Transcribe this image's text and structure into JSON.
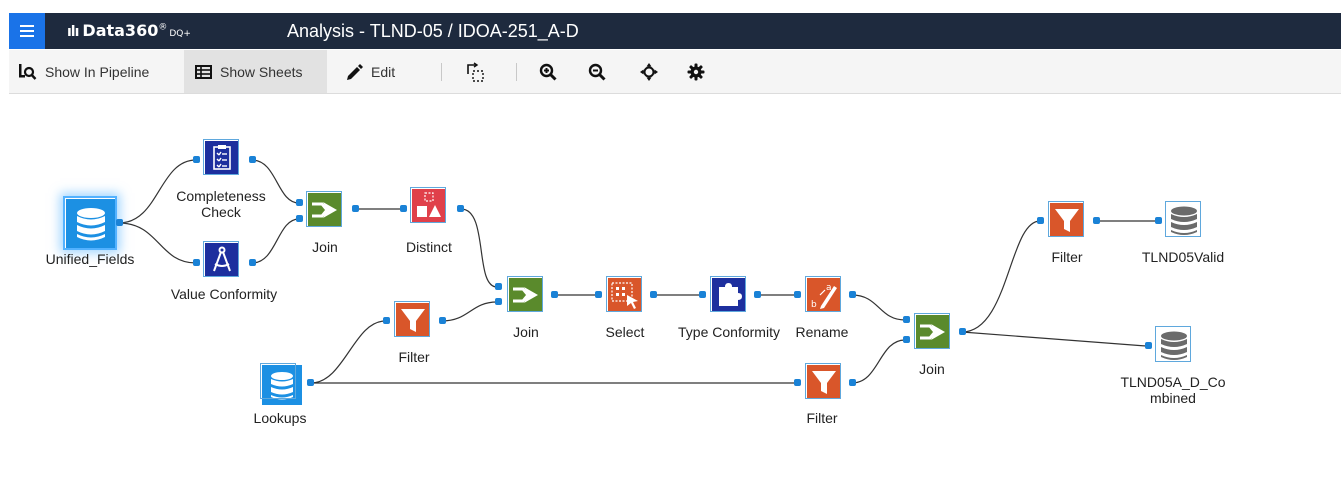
{
  "app": {
    "logo_text": "Data360",
    "logo_reg": "®",
    "logo_suffix": "DQ+",
    "title": "Analysis - TLND-05 / IDOA-251_A-D"
  },
  "toolbar": {
    "show_in_pipeline": "Show In Pipeline",
    "show_sheets": "Show Sheets",
    "edit": "Edit"
  },
  "nodes": {
    "unified_fields": "Unified_Fields",
    "completeness_check_1": "Completeness",
    "completeness_check_2": "Check",
    "value_conformity": "Value Conformity",
    "join_1": "Join",
    "distinct": "Distinct",
    "lookups": "Lookups",
    "filter_1": "Filter",
    "join_2": "Join",
    "select": "Select",
    "type_conformity": "Type Conformity",
    "rename": "Rename",
    "filter_2": "Filter",
    "join_3": "Join",
    "filter_3": "Filter",
    "tlnd05valid": "TLND05Valid",
    "tlnd05a_combined_1": "TLND05A_D_Co",
    "tlnd05a_combined_2": "mbined"
  },
  "colors": {
    "titlebar": "#1e2a3e",
    "menu_button": "#1a73e8",
    "port": "#1a82d6",
    "source_blue": "#1c90e3",
    "checklist_navy": "#1d2f9e",
    "join_green": "#5a8a2c",
    "distinct_red": "#e0404a",
    "filter_orange": "#d9562a",
    "target_gray": "#6b6b6b"
  },
  "icons": {
    "menu": "hamburger-icon",
    "pipeline": "pipeline-search-icon",
    "sheets": "table-icon",
    "edit": "pencil-icon",
    "select_area": "select-area-icon",
    "zoom_in": "zoom-in-icon",
    "zoom_out": "zoom-out-icon",
    "center": "center-target-icon",
    "settings": "gear-icon"
  }
}
